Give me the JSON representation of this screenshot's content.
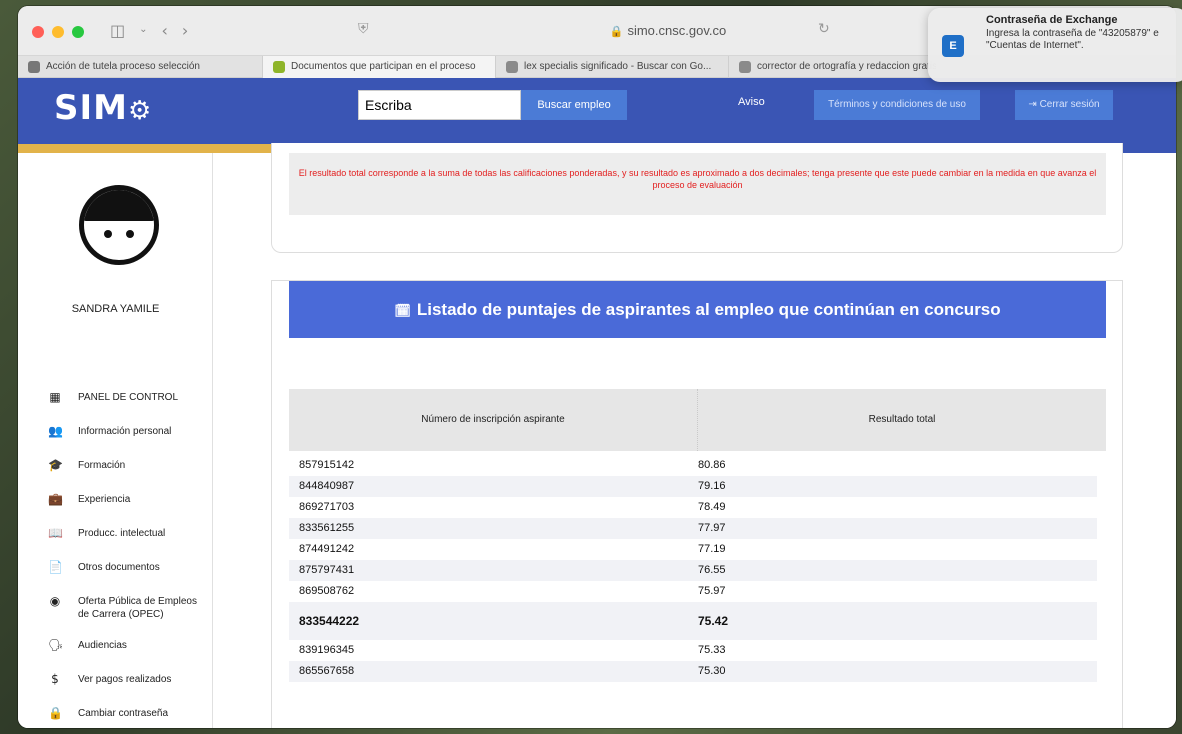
{
  "browser": {
    "address": "simo.cnsc.gov.co",
    "tabs": [
      {
        "label": "Acción de tutela proceso selección",
        "icon_color": "#777777",
        "active": false
      },
      {
        "label": "Documentos que participan en el proceso",
        "icon_color": "#8fb52a",
        "active": true
      },
      {
        "label": "lex specialis significado - Buscar con Go...",
        "icon_color": "#8a8a8a",
        "active": false
      },
      {
        "label": "corrector de ortografía y redaccion gratis",
        "icon_color": "#8a8a8a",
        "active": false
      }
    ]
  },
  "notification": {
    "title": "Contraseña de Exchange",
    "body_line1": "Ingresa la contraseña de \"43205879\" e",
    "body_line2": "\"Cuentas de Internet\"."
  },
  "header": {
    "logo": "SIM",
    "search_value": "Escriba",
    "search_button": "Buscar empleo",
    "aviso": "Aviso",
    "terms": "Términos y condiciones de uso",
    "logout": "Cerrar sesión"
  },
  "sidebar": {
    "username": "SANDRA YAMILE",
    "items": [
      {
        "icon": "dashboard-icon",
        "glyph": "▦",
        "label": "PANEL DE CONTROL"
      },
      {
        "icon": "people-icon",
        "glyph": "👥",
        "label": "Información personal"
      },
      {
        "icon": "graduation-icon",
        "glyph": "🎓",
        "label": "Formación"
      },
      {
        "icon": "briefcase-icon",
        "glyph": "💼",
        "label": "Experiencia"
      },
      {
        "icon": "book-icon",
        "glyph": "📖",
        "label": "Producc. intelectual"
      },
      {
        "icon": "document-icon",
        "glyph": "📄",
        "label": "Otros documentos"
      },
      {
        "icon": "globe-icon",
        "glyph": "◉",
        "label": "Oferta Pública de Empleos de Carrera (OPEC)"
      },
      {
        "icon": "audience-icon",
        "glyph": "🗣",
        "label": "Audiencias"
      },
      {
        "icon": "dollar-icon",
        "glyph": "$",
        "label": "Ver pagos realizados"
      },
      {
        "icon": "lock-icon",
        "glyph": "🔒",
        "label": "Cambiar contraseña"
      }
    ]
  },
  "notice": "El resultado total corresponde a la suma de todas las calificaciones ponderadas, y su resultado es aproximado a dos decimales; tenga presente que este puede cambiar en la medida en que avanza el proceso de evaluación",
  "list": {
    "title": "Listado de puntajes de aspirantes al empleo que continúan en concurso",
    "columns": [
      "Número de inscripción aspirante",
      "Resultado total"
    ],
    "rows": [
      {
        "id": "857915142",
        "score": "80.86",
        "highlight": false
      },
      {
        "id": "844840987",
        "score": "79.16",
        "highlight": false
      },
      {
        "id": "869271703",
        "score": "78.49",
        "highlight": false
      },
      {
        "id": "833561255",
        "score": "77.97",
        "highlight": false
      },
      {
        "id": "874491242",
        "score": "77.19",
        "highlight": false
      },
      {
        "id": "875797431",
        "score": "76.55",
        "highlight": false
      },
      {
        "id": "869508762",
        "score": "75.97",
        "highlight": false
      },
      {
        "id": "833544222",
        "score": "75.42",
        "highlight": true
      },
      {
        "id": "839196345",
        "score": "75.33",
        "highlight": false
      },
      {
        "id": "865567658",
        "score": "75.30",
        "highlight": false
      }
    ]
  }
}
